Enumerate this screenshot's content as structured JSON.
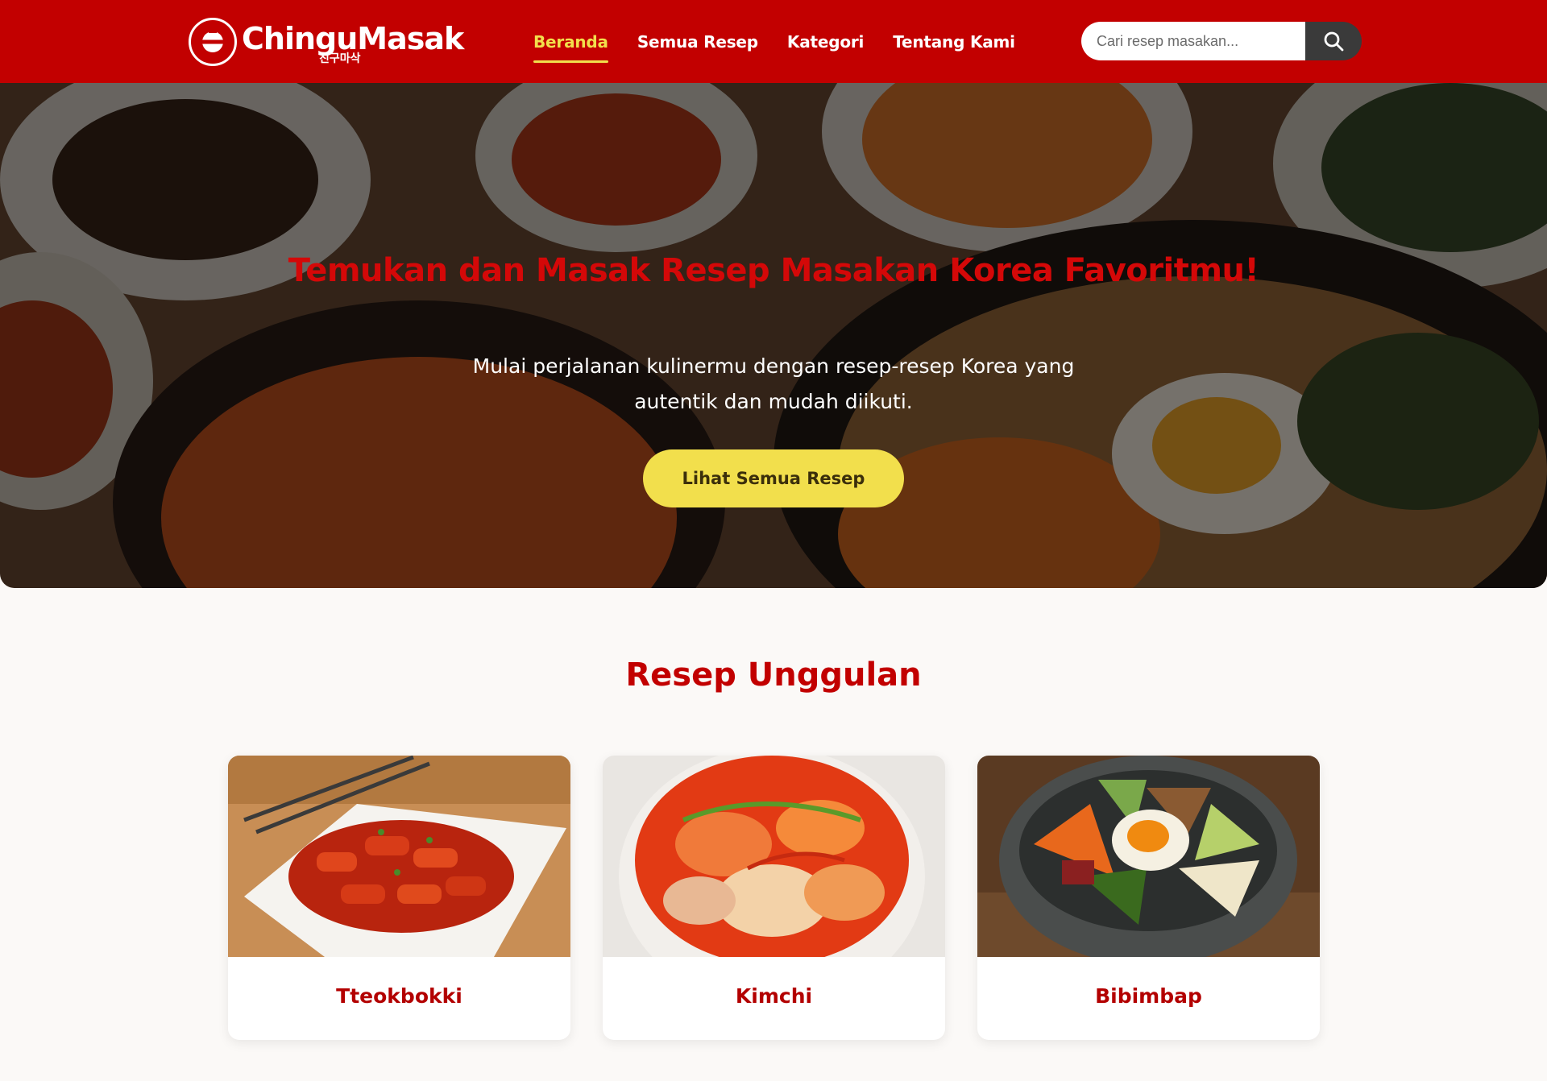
{
  "brand": {
    "name": "ChinguMasak",
    "korean": "친구마삭"
  },
  "nav": {
    "items": [
      {
        "label": "Beranda",
        "active": true
      },
      {
        "label": "Semua Resep",
        "active": false
      },
      {
        "label": "Kategori",
        "active": false
      },
      {
        "label": "Tentang Kami",
        "active": false
      }
    ]
  },
  "search": {
    "placeholder": "Cari resep masakan...",
    "icon": "search-icon"
  },
  "hero": {
    "title": "Temukan dan Masak Resep Masakan Korea Favoritmu!",
    "subtitle": "Mulai perjalanan kulinermu dengan resep-resep Korea yang autentik dan mudah diikuti.",
    "button_label": "Lihat Semua Resep"
  },
  "featured": {
    "title": "Resep Unggulan",
    "recipes": [
      {
        "name": "Tteokbokki"
      },
      {
        "name": "Kimchi"
      },
      {
        "name": "Bibimbap"
      }
    ]
  },
  "colors": {
    "primary": "#c20000",
    "accent": "#f2df4c",
    "search_button": "#3a3a3a",
    "page_background": "#fbf9f7"
  }
}
